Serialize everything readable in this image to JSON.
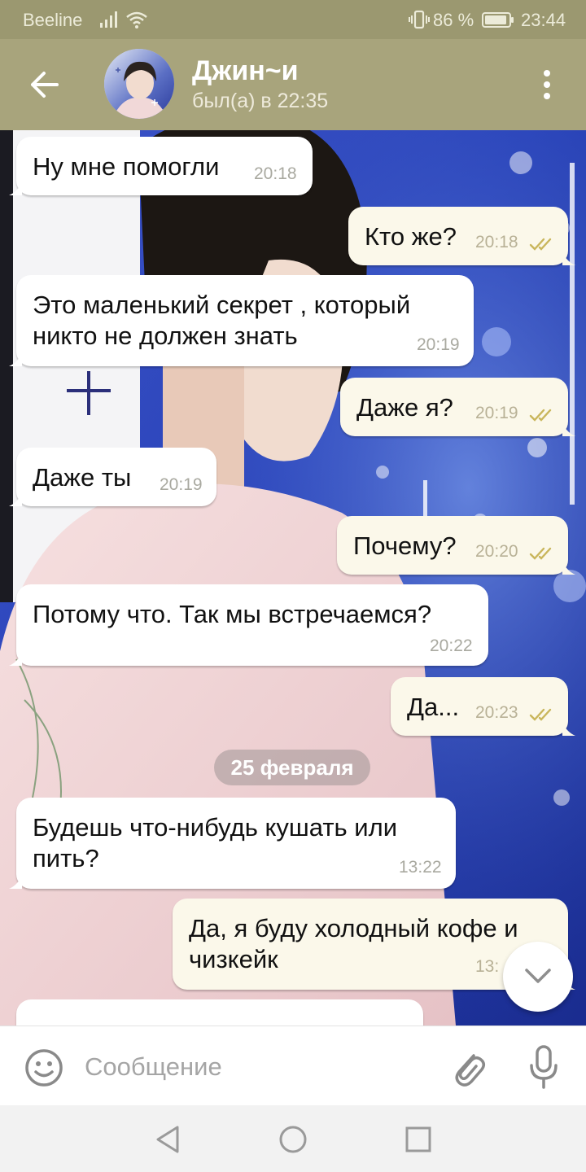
{
  "status_bar": {
    "carrier": "Beeline",
    "battery_percent": "86 %",
    "clock": "23:44"
  },
  "chat_header": {
    "contact_name": "Джин~и",
    "last_seen": "был(а) в 22:35"
  },
  "messages": [
    {
      "direction": "in",
      "lines": [
        "Ну мне помогли"
      ],
      "time": "20:18"
    },
    {
      "direction": "out",
      "lines": [
        "Кто же?"
      ],
      "time": "20:18",
      "read": true
    },
    {
      "direction": "in",
      "lines": [
        "Это маленький секрет , который",
        "никто не должен знать"
      ],
      "time": "20:19"
    },
    {
      "direction": "out",
      "lines": [
        "Даже я?"
      ],
      "time": "20:19",
      "read": true
    },
    {
      "direction": "in",
      "lines": [
        "Даже ты"
      ],
      "time": "20:19"
    },
    {
      "direction": "out",
      "lines": [
        "Почему?"
      ],
      "time": "20:20",
      "read": true
    },
    {
      "direction": "in",
      "lines": [
        "Потому что. Так мы встречаемся?"
      ],
      "time": "20:22"
    },
    {
      "direction": "out",
      "lines": [
        "Да..."
      ],
      "time": "20:23",
      "read": true
    },
    {
      "direction": "in",
      "lines": [
        "Будешь что-нибудь кушать или",
        "пить?"
      ],
      "time": "13:22"
    },
    {
      "direction": "out",
      "lines": [
        "Да, я буду холодный кофе и",
        "чизкейк"
      ],
      "time": "13:",
      "read": true
    }
  ],
  "date_separator": "25 февраля",
  "input": {
    "placeholder": "Сообщение"
  },
  "colors": {
    "header": "#a8a47c",
    "status_bar": "#9b9870",
    "incoming_bubble": "#ffffff",
    "outgoing_bubble": "#fbf8ea",
    "read_check": "#c9b65c"
  },
  "icons": [
    "back-arrow-icon",
    "more-vert-icon",
    "emoji-icon",
    "attach-icon",
    "mic-icon",
    "chevron-down-icon",
    "nav-back-icon",
    "nav-home-icon",
    "nav-recents-icon"
  ]
}
